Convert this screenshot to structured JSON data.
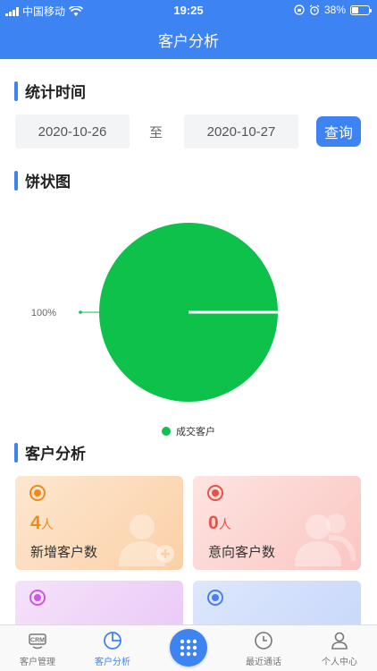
{
  "status_bar": {
    "carrier": "中国移动",
    "time": "19:25",
    "battery_percent": "38%",
    "battery_level": 0.38
  },
  "header": {
    "title": "客户分析"
  },
  "stat_time": {
    "section_title": "统计时间",
    "start_date": "2020-10-26",
    "to_label": "至",
    "end_date": "2020-10-27",
    "query_label": "查询"
  },
  "pie_section": {
    "section_title": "饼状图"
  },
  "chart_data": {
    "type": "pie",
    "slices": [
      {
        "name": "成交客户",
        "value": 100,
        "label": "100%",
        "color": "#0ec14b"
      }
    ],
    "legend_position": "bottom"
  },
  "analysis": {
    "section_title": "客户分析",
    "cards": [
      {
        "value": "4",
        "unit": "人",
        "label": "新增客户数",
        "color": "#f08a1c",
        "icon": "target-icon"
      },
      {
        "value": "0",
        "unit": "人",
        "label": "意向客户数",
        "color": "#e8504a",
        "icon": "target-icon"
      },
      {
        "value": "",
        "unit": "",
        "label": "",
        "color": "#c65be0",
        "icon": "target-icon"
      },
      {
        "value": "",
        "unit": "",
        "label": "",
        "color": "#4a7ff0",
        "icon": "target-icon"
      }
    ]
  },
  "tabbar": {
    "tabs": [
      {
        "label": "客户管理",
        "icon": "crm-icon"
      },
      {
        "label": "客户分析",
        "icon": "pie-chart-icon"
      },
      {
        "label": "",
        "icon": "grid-dots-icon"
      },
      {
        "label": "最近通话",
        "icon": "clock-icon"
      },
      {
        "label": "个人中心",
        "icon": "user-icon"
      }
    ],
    "active_index": 1
  }
}
